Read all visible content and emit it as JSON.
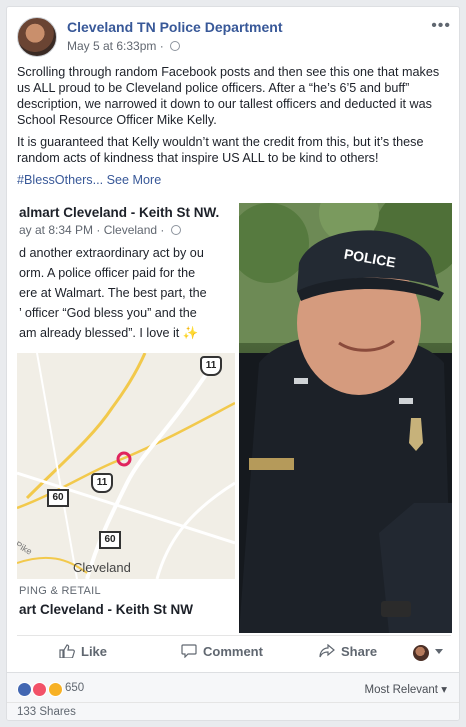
{
  "post": {
    "page_name": "Cleveland TN Police Department",
    "timestamp": "May 5 at 6:33pm",
    "separator": "·",
    "more_label": "•••",
    "paragraph_1": "Scrolling through random Facebook posts and then see this one that makes us ALL proud to be Cleveland police officers. After a “he’s 6’5 and buff” description, we narrowed it down to our tallest officers and deducted it was School Resource Officer Mike Kelly.",
    "paragraph_2": "It is guaranteed that Kelly wouldn’t want the credit from this, but it’s these random acts of kindness that inspire US ALL to be kind to others!",
    "hashtag": "#BlessOthers...",
    "see_more": "See More"
  },
  "shared": {
    "title": "almart Cleveland - Keith St NW.",
    "meta": "ay at 8:34 PM · Cleveland ·",
    "lines": [
      "d another extraordinary act by ou",
      "orm. A police officer paid for the",
      "ere at Walmart. The best part, the",
      "’ officer “God bless you” and the",
      "am already blessed”. I love it"
    ],
    "map_city": "Cleveland",
    "map_pike": "Pike",
    "shield_us_top": "11",
    "shield_us_mid": "11",
    "shield_st_1": "60",
    "shield_st_2": "60",
    "category": "PING & RETAIL",
    "place": "art Cleveland - Keith St NW"
  },
  "photo": {
    "cap_text": "POLICE"
  },
  "actions": {
    "like": "Like",
    "comment": "Comment",
    "share": "Share"
  },
  "reactions": {
    "count": "650",
    "sort": "Most Relevant",
    "sort_caret": "▾",
    "shares": "133 Shares"
  },
  "colors": {
    "link": "#385898",
    "like": "#4267b2",
    "love": "#f25268",
    "wow": "#f7b125",
    "map_pin": "#e0245e"
  }
}
